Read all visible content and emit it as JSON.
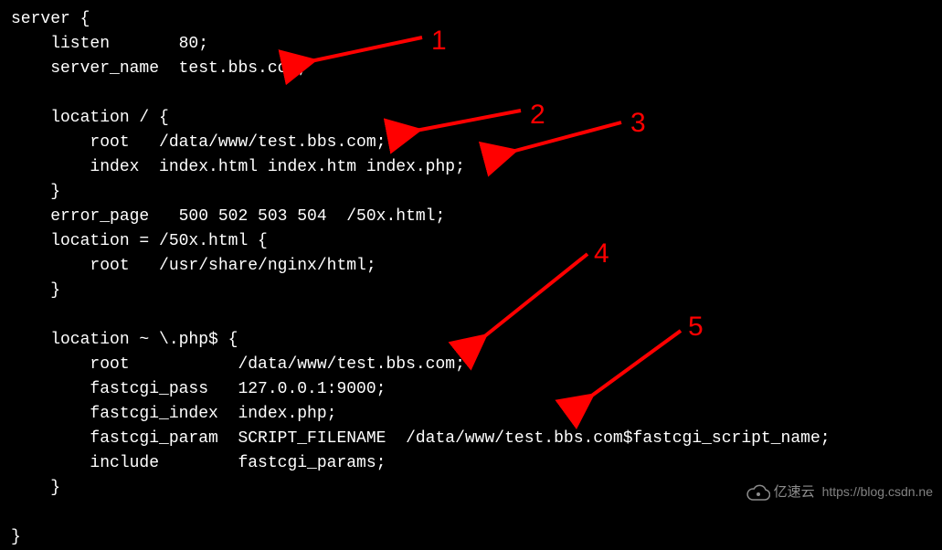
{
  "code": {
    "l01": "server {",
    "l02": "    listen       80;",
    "l03": "    server_name  test.bbs.com;",
    "l04": "",
    "l05": "    location / {",
    "l06": "        root   /data/www/test.bbs.com;",
    "l07": "        index  index.html index.htm index.php;",
    "l08": "    }",
    "l09": "    error_page   500 502 503 504  /50x.html;",
    "l10": "    location = /50x.html {",
    "l11": "        root   /usr/share/nginx/html;",
    "l12": "    }",
    "l13": "",
    "l14": "    location ~ \\.php$ {",
    "l15": "        root           /data/www/test.bbs.com;",
    "l16": "        fastcgi_pass   127.0.0.1:9000;",
    "l17": "        fastcgi_index  index.php;",
    "l18": "        fastcgi_param  SCRIPT_FILENAME  /data/www/test.bbs.com$fastcgi_script_name;",
    "l19": "        include        fastcgi_params;",
    "l20": "    }",
    "l21": "",
    "l22": "}"
  },
  "annotations": {
    "n1": "1",
    "n2": "2",
    "n3": "3",
    "n4": "4",
    "n5": "5"
  },
  "watermark": {
    "brand": "亿速云",
    "url": "https://blog.csdn.ne"
  }
}
